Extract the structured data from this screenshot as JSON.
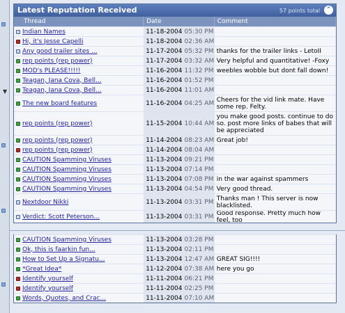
{
  "header": {
    "title": "Latest Reputation Received",
    "points_total": "57 points total",
    "collapse_glyph": "⌃"
  },
  "columns": {
    "thread": "Thread",
    "date": "Date",
    "comment": "Comment"
  },
  "rows_top": [
    {
      "status": "blue",
      "thread": "Indian Names",
      "date": "11-18-2004",
      "time": "05:30 PM",
      "comment": "",
      "h": 14
    },
    {
      "status": "red",
      "thread": "Hi, it's Jesse Capelli",
      "date": "11-18-2004",
      "time": "02:36 AM",
      "comment": "",
      "h": 14
    },
    {
      "status": "blue",
      "thread": "Any good trailer sites ...",
      "date": "11-17-2004",
      "time": "05:32 PM",
      "comment": "thanks for the trailer links - LetoII",
      "h": 14
    },
    {
      "status": "green",
      "thread": "rep points (rep power)",
      "date": "11-17-2004",
      "time": "03:32 AM",
      "comment": "Very helpful and quantitative! -Foxy",
      "h": 14
    },
    {
      "status": "green",
      "thread": "MOD's PLEASE!!!!!",
      "date": "11-16-2004",
      "time": "11:32 PM",
      "comment": "weebles wobble but dont fall down!",
      "h": 14
    },
    {
      "status": "green",
      "thread": "Teagan, Jana Cova, Bell...",
      "date": "11-16-2004",
      "time": "01:52 PM",
      "comment": "",
      "h": 14
    },
    {
      "status": "green",
      "thread": "Teagan, Jana Cova, Bell...",
      "date": "11-16-2004",
      "time": "11:01 AM",
      "comment": "",
      "h": 14
    },
    {
      "status": "green",
      "thread": "The new board features",
      "date": "11-16-2004",
      "time": "04:25 AM",
      "comment": "Cheers for the vid link mate. Have some rep. Felty.",
      "h": 24
    },
    {
      "status": "green",
      "thread": "rep points (rep power)",
      "date": "11-15-2004",
      "time": "10:44 AM",
      "comment": "you make good posts. continue to do so. post more links of babes that will be appreciated",
      "h": 34
    },
    {
      "status": "green",
      "thread": "rep points (rep power)",
      "date": "11-14-2004",
      "time": "08:23 AM",
      "comment": "Great job!",
      "h": 14
    },
    {
      "status": "red",
      "thread": "rep points (rep power)",
      "date": "11-14-2004",
      "time": "08:04 AM",
      "comment": "",
      "h": 14
    },
    {
      "status": "green",
      "thread": "CAUTION Spamming Viruses",
      "date": "11-13-2004",
      "time": "09:21 PM",
      "comment": "",
      "h": 14
    },
    {
      "status": "green",
      "thread": "CAUTION Spamming Viruses",
      "date": "11-13-2004",
      "time": "07:14 PM",
      "comment": "",
      "h": 14
    },
    {
      "status": "green",
      "thread": "CAUTION Spamming Viruses",
      "date": "11-13-2004",
      "time": "07:08 PM",
      "comment": "in the war against spammers",
      "h": 14
    },
    {
      "status": "green",
      "thread": "CAUTION Spamming Viruses",
      "date": "11-13-2004",
      "time": "04:54 PM",
      "comment": "Very good thread.",
      "h": 14
    },
    {
      "status": "blue",
      "thread": "Nextdoor Nikki",
      "date": "11-13-2004",
      "time": "03:31 PM",
      "comment": "Thanks man ! This server is now blacklisted.",
      "h": 24
    },
    {
      "status": "blue",
      "thread": "Verdict: Scott Peterson...",
      "date": "11-13-2004",
      "time": "03:31 PM",
      "comment": "Good response. Pretty much how feel, too",
      "h": 18
    }
  ],
  "rows_bottom": [
    {
      "status": "green",
      "thread": "CAUTION Spamming Viruses",
      "date": "11-13-2004",
      "time": "03:28 PM",
      "comment": "",
      "h": 14
    },
    {
      "status": "green",
      "thread": "Ok, this is faarkin fun...",
      "date": "11-13-2004",
      "time": "02:11 PM",
      "comment": "",
      "h": 14
    },
    {
      "status": "green",
      "thread": "How to Set Up a Signatu...",
      "date": "11-13-2004",
      "time": "12:47 AM",
      "comment": "GREAT SIG!!!!",
      "h": 14
    },
    {
      "status": "green",
      "thread": "*Great Idea*",
      "date": "11-12-2004",
      "time": "07:38 AM",
      "comment": "here you go",
      "h": 14
    },
    {
      "status": "red",
      "thread": "Identify yourself",
      "date": "11-11-2004",
      "time": "06:21 PM",
      "comment": "",
      "h": 14
    },
    {
      "status": "red",
      "thread": "Identify yourself",
      "date": "11-11-2004",
      "time": "02:25 PM",
      "comment": "",
      "h": 14
    },
    {
      "status": "green",
      "thread": "Words, Quotes, and Crac...",
      "date": "11-11-2004",
      "time": "07:10 AM",
      "comment": "",
      "h": 14
    }
  ],
  "colors": {
    "title_bar": "#3f5f9e",
    "column_header": "#7c93bd",
    "link": "#22229c",
    "positive": "#3fa046",
    "negative": "#b52a2a"
  }
}
